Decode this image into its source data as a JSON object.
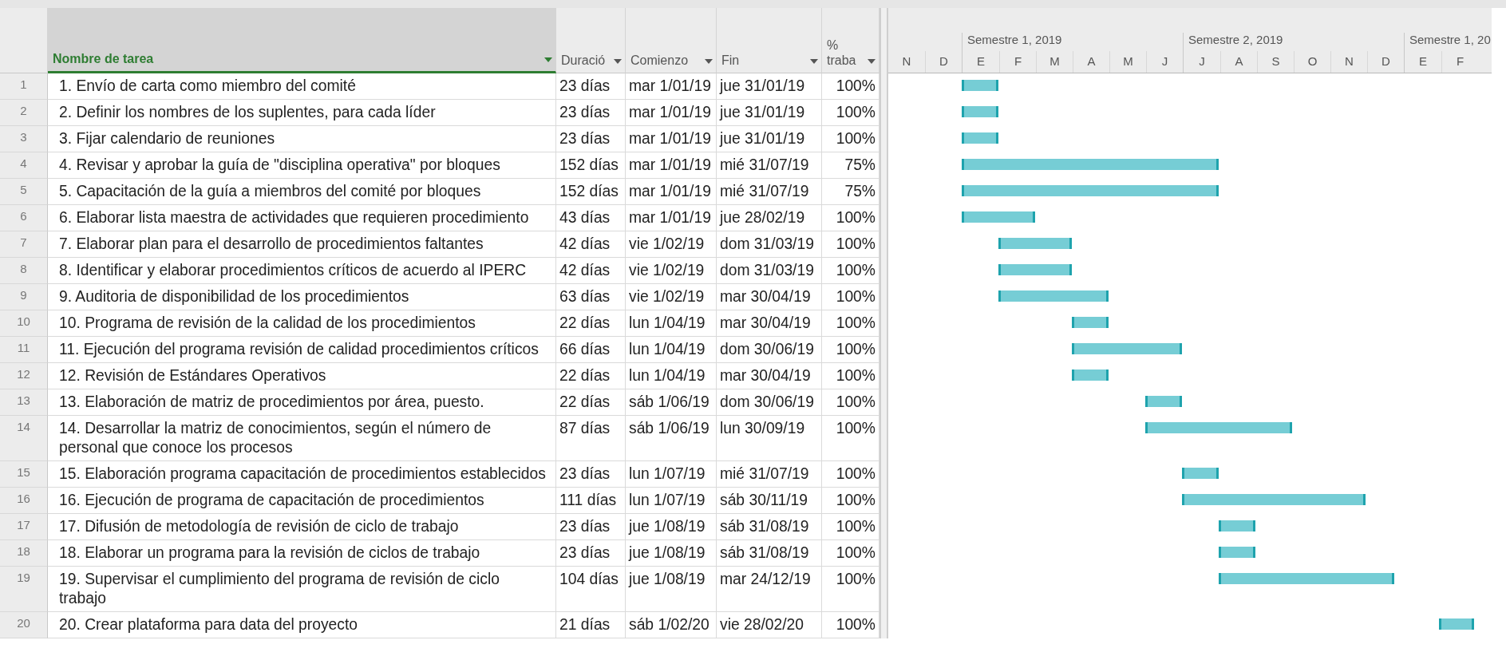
{
  "columns": [
    {
      "label": "Nombre de tarea",
      "selected": true
    },
    {
      "label": "Duració",
      "selected": false
    },
    {
      "label": "Comienzo",
      "selected": false
    },
    {
      "label": "Fin",
      "selected": false
    },
    {
      "label": "% traba",
      "selected": false
    }
  ],
  "timeline": {
    "semesters": [
      {
        "months": [
          "N",
          "D"
        ]
      },
      {
        "label": "Semestre 1, 2019",
        "months": [
          "E",
          "F",
          "M",
          "A",
          "M",
          "J"
        ]
      },
      {
        "label": "Semestre 2, 2019",
        "months": [
          "J",
          "A",
          "S",
          "O",
          "N",
          "D"
        ]
      },
      {
        "label": "Semestre 1, 20",
        "months": [
          "E",
          "F"
        ]
      }
    ]
  },
  "rows": [
    {
      "num": "1",
      "name": "1. Envío de carta como miembro del comité",
      "duration": "23 días",
      "start": "mar 1/01/19",
      "finish": "jue 31/01/19",
      "percent": "100%"
    },
    {
      "num": "2",
      "name": "2. Definir los nombres  de los suplentes, para cada líder",
      "duration": "23 días",
      "start": "mar 1/01/19",
      "finish": "jue 31/01/19",
      "percent": "100%"
    },
    {
      "num": "3",
      "name": "3. Fijar calendario de reuniones",
      "duration": "23 días",
      "start": "mar 1/01/19",
      "finish": "jue 31/01/19",
      "percent": "100%"
    },
    {
      "num": "4",
      "name": "4. Revisar y aprobar la guía de \"disciplina operativa\" por bloques",
      "duration": "152 días",
      "start": "mar 1/01/19",
      "finish": "mié 31/07/19",
      "percent": "75%"
    },
    {
      "num": "5",
      "name": "5. Capacitación de la guía a miembros del comité por bloques",
      "duration": "152 días",
      "start": "mar 1/01/19",
      "finish": "mié 31/07/19",
      "percent": "75%"
    },
    {
      "num": "6",
      "name": "6. Elaborar lista maestra de actividades que requieren procedimiento",
      "duration": "43 días",
      "start": "mar 1/01/19",
      "finish": "jue 28/02/19",
      "percent": "100%"
    },
    {
      "num": "7",
      "name": "7. Elaborar plan para el desarrollo de procedimientos faltantes",
      "duration": "42 días",
      "start": "vie 1/02/19",
      "finish": "dom 31/03/19",
      "percent": "100%"
    },
    {
      "num": "8",
      "name": "8. Identificar y elaborar procedimientos críticos de acuerdo al IPERC",
      "duration": "42 días",
      "start": "vie 1/02/19",
      "finish": "dom 31/03/19",
      "percent": "100%"
    },
    {
      "num": "9",
      "name": "9. Auditoria de disponibilidad de los procedimientos",
      "duration": "63 días",
      "start": "vie 1/02/19",
      "finish": "mar 30/04/19",
      "percent": "100%"
    },
    {
      "num": "10",
      "name": "10. Programa de revisión de la calidad de los procedimientos",
      "duration": "22 días",
      "start": "lun 1/04/19",
      "finish": "mar 30/04/19",
      "percent": "100%"
    },
    {
      "num": "11",
      "name": "11. Ejecución del programa revisión de calidad procedimientos críticos",
      "duration": "66 días",
      "start": "lun 1/04/19",
      "finish": "dom 30/06/19",
      "percent": "100%"
    },
    {
      "num": "12",
      "name": "12. Revisión de Estándares Operativos",
      "duration": "22 días",
      "start": "lun 1/04/19",
      "finish": "mar 30/04/19",
      "percent": "100%"
    },
    {
      "num": "13",
      "name": "13. Elaboración de matriz de procedimientos por área, puesto.",
      "duration": "22 días",
      "start": "sáb 1/06/19",
      "finish": "dom 30/06/19",
      "percent": "100%"
    },
    {
      "num": "14",
      "name": "14. Desarrollar la matriz de conocimientos, según el número de personal que conoce los procesos",
      "duration": "87 días",
      "start": "sáb 1/06/19",
      "finish": "lun 30/09/19",
      "percent": "100%"
    },
    {
      "num": "15",
      "name": "15. Elaboración programa capacitación de  procedimientos establecidos",
      "duration": "23 días",
      "start": "lun 1/07/19",
      "finish": "mié 31/07/19",
      "percent": "100%"
    },
    {
      "num": "16",
      "name": "16. Ejecución de programa de capacitación de procedimientos",
      "duration": "111 días",
      "start": "lun 1/07/19",
      "finish": "sáb 30/11/19",
      "percent": "100%"
    },
    {
      "num": "17",
      "name": "17. Difusión de metodología de revisión de ciclo de trabajo",
      "duration": "23 días",
      "start": "jue 1/08/19",
      "finish": "sáb 31/08/19",
      "percent": "100%"
    },
    {
      "num": "18",
      "name": "18. Elaborar un programa para la revisión de ciclos de trabajo",
      "duration": "23 días",
      "start": "jue 1/08/19",
      "finish": "sáb 31/08/19",
      "percent": "100%"
    },
    {
      "num": "19",
      "name": "19. Supervisar el cumplimiento del programa de revisión de ciclo trabajo",
      "duration": "104 días",
      "start": "jue 1/08/19",
      "finish": "mar 24/12/19",
      "percent": "100%"
    },
    {
      "num": "20",
      "name": "20. Crear plataforma para data del proyecto",
      "duration": "21 días",
      "start": "sáb 1/02/20",
      "finish": "vie 28/02/20",
      "percent": "100%"
    }
  ]
}
